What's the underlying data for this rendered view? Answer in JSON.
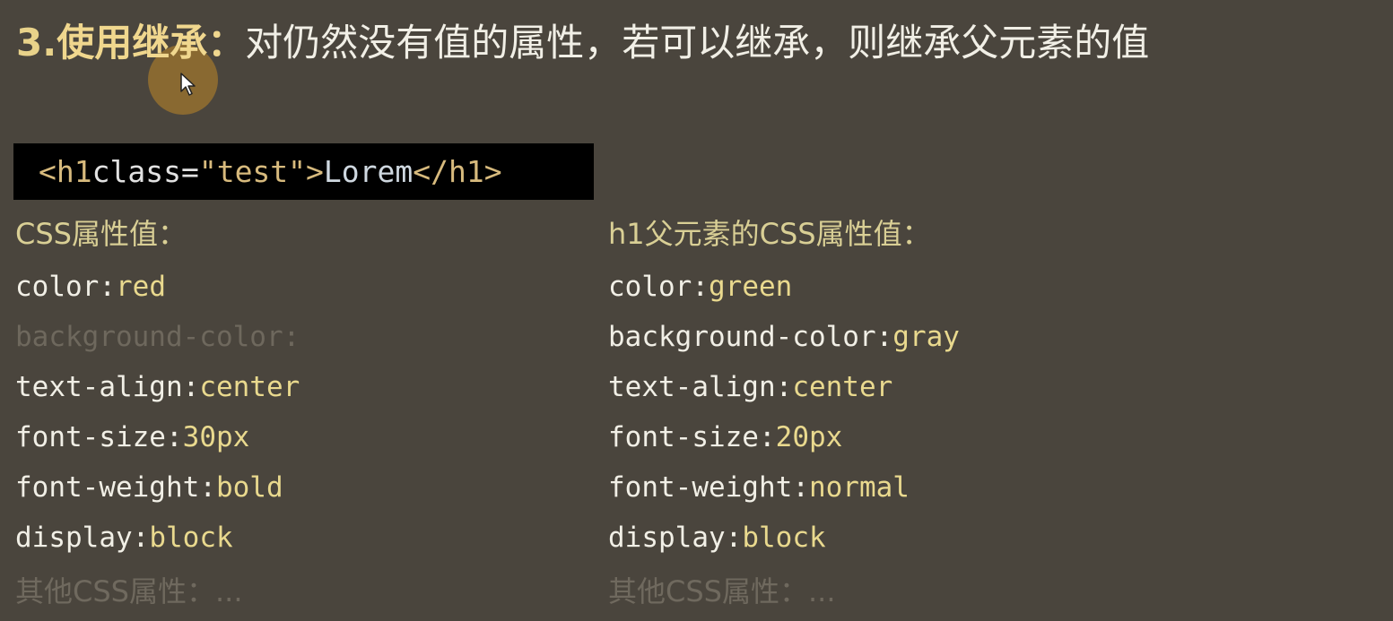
{
  "title": {
    "number": "3.",
    "keyword": "使用继承",
    "colon": "：",
    "description": "对仍然没有值的属性，若可以继承，则继承父元素的值"
  },
  "code": {
    "open_tag_start": "<h1",
    "attr_name": " class=",
    "attr_value": "\"test\"",
    "open_tag_end": ">",
    "content": "Lorem",
    "close_tag": "</h1>"
  },
  "left_column": {
    "heading": "CSS属性值：",
    "properties": [
      {
        "name": "color",
        "value": "red"
      },
      {
        "name": "background-color",
        "value": ""
      },
      {
        "name": "text-align",
        "value": "center"
      },
      {
        "name": "font-size",
        "value": "30px"
      },
      {
        "name": "font-weight",
        "value": "bold"
      },
      {
        "name": "display",
        "value": "block"
      }
    ],
    "other": "其他CSS属性：..."
  },
  "right_column": {
    "heading": "h1父元素的CSS属性值：",
    "properties": [
      {
        "name": "color",
        "value": "green"
      },
      {
        "name": "background-color",
        "value": "gray"
      },
      {
        "name": "text-align",
        "value": "center"
      },
      {
        "name": "font-size",
        "value": "20px"
      },
      {
        "name": "font-weight",
        "value": "normal"
      },
      {
        "name": "display",
        "value": "block"
      }
    ],
    "other": "其他CSS属性：..."
  },
  "colors": {
    "background": "#4a453d",
    "code_background": "#000000",
    "heading_yellow": "#d9cf95",
    "value_yellow": "#e9d98e",
    "cursor_highlight": "#be8728"
  },
  "icons": {
    "cursor": "mouse-pointer-icon"
  }
}
